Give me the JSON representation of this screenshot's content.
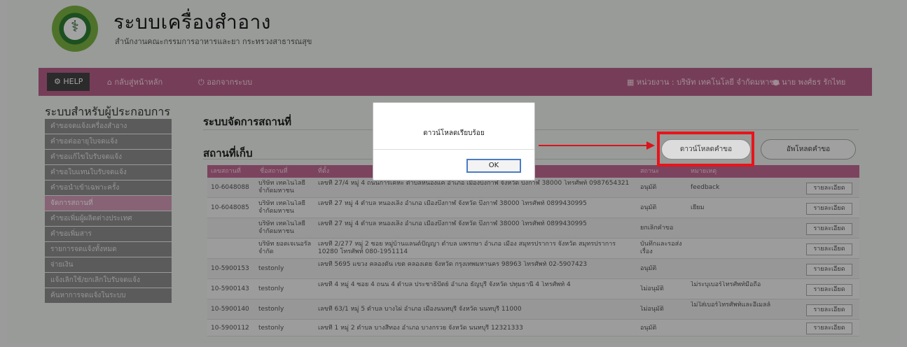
{
  "header": {
    "title": "ระบบเครื่องสำอาง",
    "subtitle": "สำนักงานคณะกรรมการอาหารและยา กระทรวงสาธารณสุข"
  },
  "navbar": {
    "help": "HELP",
    "home": "กลับสู่หน้าหลัก",
    "logout": "ออกจากระบบ",
    "agency": "หน่วยงาน : บริษัท เทคโนโลยี จำกัดมหาชน",
    "user": "นาย พงศ์ธร รักไทย"
  },
  "sidebar": {
    "title": "ระบบสำหรับผู้ประกอบการ",
    "items": [
      {
        "label": "คำขอจดแจ้งเครื่องสำอาง"
      },
      {
        "label": "คำขอต่ออายุใบจดแจ้ง"
      },
      {
        "label": "คำขอแก้ไขใบรับจดแจ้ง"
      },
      {
        "label": "คำขอใบแทนใบรับจดแจ้ง"
      },
      {
        "label": "คำขอนำเข้าเฉพาะครั้ง"
      },
      {
        "label": "จัดการสถานที่"
      },
      {
        "label": "คำขอเพิ่มผู้ผลิตต่างประเทศ"
      },
      {
        "label": "คำขอเพิ่มสาร"
      },
      {
        "label": "รายการจดแจ้งทั้งหมด"
      },
      {
        "label": "จ่ายเงิน"
      },
      {
        "label": "แจ้งเลิกใช้/ยกเลิกใบรับจดแจ้ง"
      },
      {
        "label": "ค้นหาการจดแจ้งในระบบ"
      }
    ]
  },
  "main": {
    "title": "ระบบจัดการสถานที่",
    "section": "สถานที่เก็บ",
    "download_button": "ดาวน์โหลดคำขอ",
    "upload_button": "อัพโหลดคำขอ"
  },
  "table": {
    "headers": [
      "เลขสถานที่",
      "ชื่อสถานที่",
      "ที่ตั้ง",
      "สถานะ",
      "หมายเหตุ"
    ],
    "detail_label": "รายละเอียด",
    "rows": [
      {
        "code": "10-6048088",
        "name": "บริษัท เทคโนโลยี จำกัดมหาชน",
        "address": "เลขที่ 27/4 หมู่ 4 ถนนการเคหะ ตำบลหนองแค อำเภอ เมืองบึงกาฬ จังหวัด บึงกาฬ 38000 โทรศัพท์ 0987654321",
        "status": "อนุมัติ",
        "note": "feedback"
      },
      {
        "code": "10-6048085",
        "name": "บริษัท เทคโนโลยี จำกัดมหาชน",
        "address": "เลขที่ 27 หมู่ 4 ตำบล หนองเลิง อำเภอ เมืองบึงกาฬ จังหวัด บึงกาฬ 38000 โทรศัพท์ 0899430995",
        "status": "อนุมัติ",
        "note": "เยี่ยม"
      },
      {
        "code": "",
        "name": "บริษัท เทคโนโลยี จำกัดมหาชน",
        "address": "เลขที่ 27 หมู่ 4 ตำบล หนองเลิง อำเภอ เมืองบึงกาฬ จังหวัด บึงกาฬ 38000 โทรศัพท์ 0899430995",
        "status": "ยกเลิกคำขอ",
        "note": ""
      },
      {
        "code": "",
        "name": "บริษัท ยอดเจเนอรัล จำกัด",
        "address": "เลขที่ 2/277 หมู่ 2 ซอย หมู่บ้านแลนด์ปัญญา ตำบล แพรกษา อำเภอ เมือง สมุทรปราการ จังหวัด สมุทรปราการ 10280 โทรศัพท์ 080-1951114",
        "status": "บันทึกและรอส่งเรื่อง",
        "note": ""
      },
      {
        "code": "10-5900153",
        "name": "testonly",
        "address": "เลขที่ 5695 แขวง คลองตัน เขต คลองเตย จังหวัด กรุงเทพมหานคร 98963 โทรศัพท์ 02-5907423",
        "status": "อนุมัติ",
        "note": ""
      },
      {
        "code": "10-5900143",
        "name": "testonly",
        "address": "เลขที่ 4 หมู่ 4 ซอย 4 ถนน 4 ตำบล ประชาธิปัตย์ อำเภอ ธัญบุรี จังหวัด ปทุมธานี 4 โทรศัพท์ 4",
        "status": "ไม่อนุมัติ",
        "note": "ไม่ระบุเบอร์โทรศัพท์มือถือ"
      },
      {
        "code": "10-5900140",
        "name": "testonly",
        "address": "เลขที่ 63/1 หมู่ 5 ตำบล บางไผ่ อำเภอ เมืองนนทบุรี จังหวัด นนทบุรี 11000",
        "status": "ไม่อนุมัติ",
        "note": "ไม่ใส่เบอร์โทรศัพท์และอีเมลล์"
      },
      {
        "code": "10-5900112",
        "name": "testonly",
        "address": "เลขที่ 1 หมู่ 2 ตำบล บางสีทอง อำเภอ บางกรวย จังหวัด นนทบุรี 12321333",
        "status": "อนุมัติ",
        "note": ""
      }
    ]
  },
  "modal": {
    "message": "ดาวน์โหลดเรียบร้อย",
    "ok": "OK"
  }
}
